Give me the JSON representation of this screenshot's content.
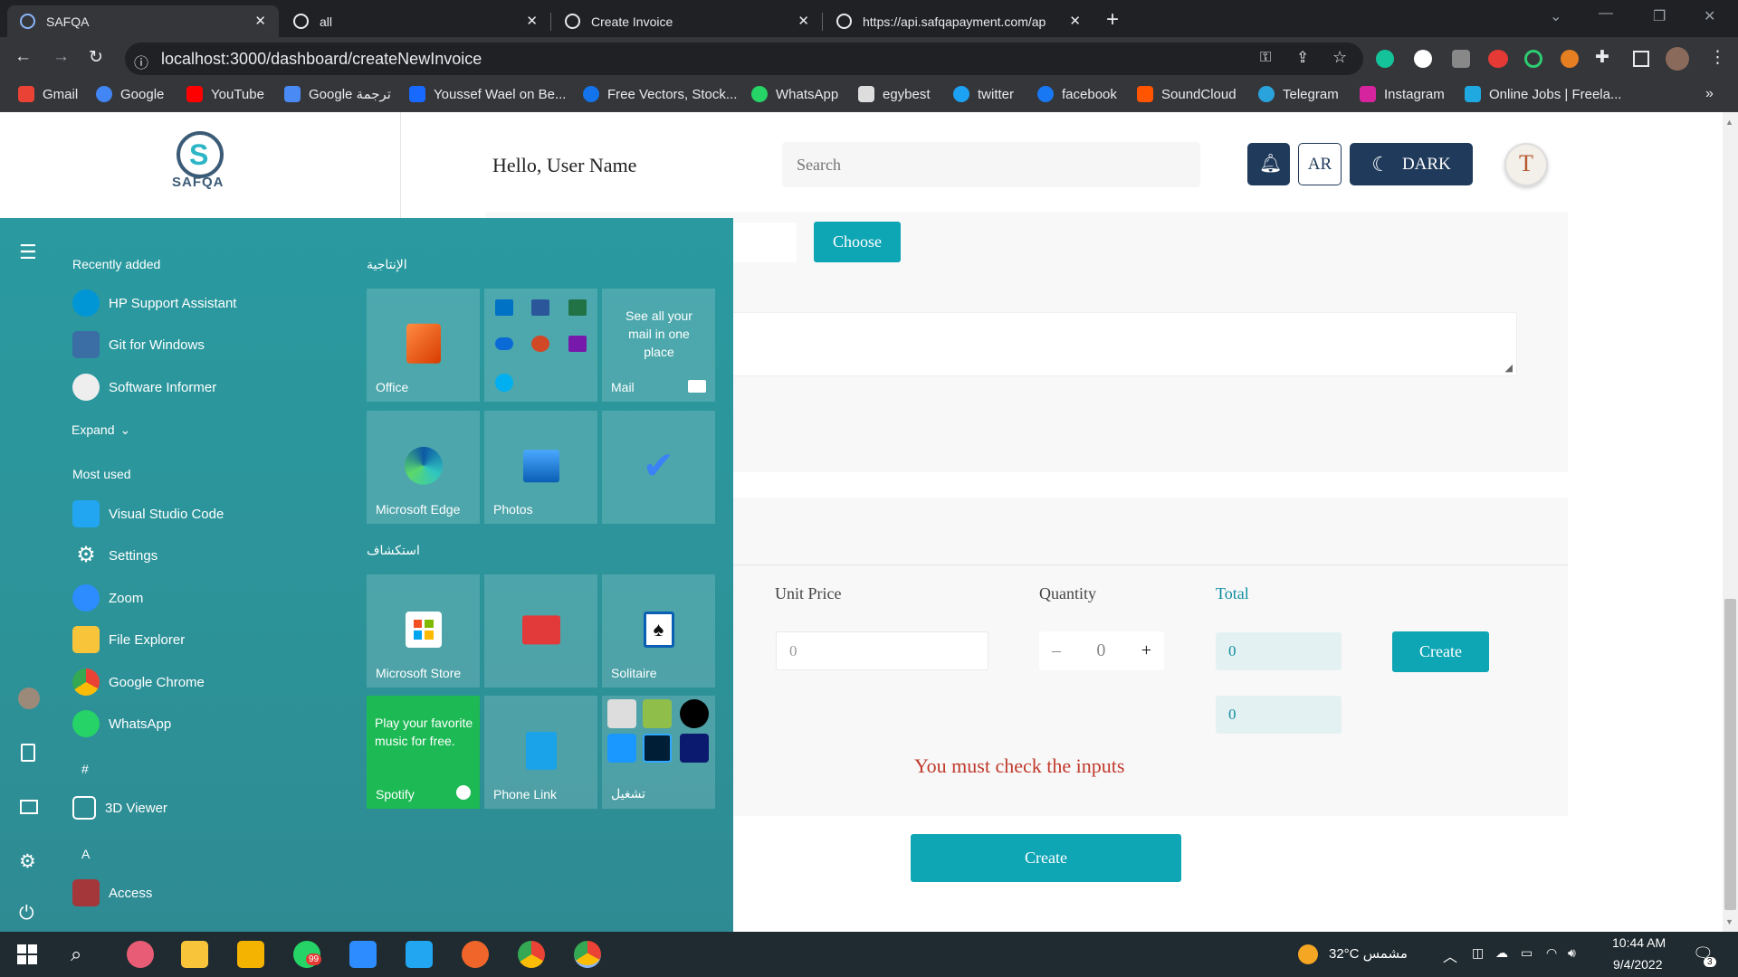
{
  "browser": {
    "tabs": [
      {
        "title": "SAFQA"
      },
      {
        "title": "all"
      },
      {
        "title": "Create Invoice"
      },
      {
        "title": "https://api.safqapayment.com/ap"
      }
    ],
    "url": "localhost:3000/dashboard/createNewInvoice",
    "bookmarks": [
      "Gmail",
      "Google",
      "YouTube",
      "Google ترجمة",
      "Youssef Wael on Be...",
      "Free Vectors, Stock...",
      "WhatsApp",
      "egybest",
      "twitter",
      "facebook",
      "SoundCloud",
      "Telegram",
      "Instagram",
      "Online Jobs | Freela..."
    ]
  },
  "header": {
    "logo_text": "SAFQA",
    "greeting": "Hello, User Name",
    "search_placeholder": "Search",
    "lang_button": "AR",
    "theme_button": "DARK"
  },
  "form": {
    "choose_button": "Choose",
    "columns": {
      "unit_price": "Unit Price",
      "quantity": "Quantity",
      "total": "Total"
    },
    "unit_price_placeholder": "0",
    "quantity_value": "0",
    "quantity_minus": "–",
    "quantity_plus": "+",
    "total_value": "0",
    "grand_total_value": "0",
    "row_create": "Create",
    "error": "You must check the inputs",
    "create_button": "Create"
  },
  "start_menu": {
    "recently_added_label": "Recently added",
    "recent": [
      "HP Support Assistant",
      "Git for Windows",
      "Software Informer"
    ],
    "expand": "Expand",
    "most_used_label": "Most used",
    "most_used": [
      "Visual Studio Code",
      "Settings",
      "Zoom",
      "File Explorer",
      "Google Chrome",
      "WhatsApp"
    ],
    "hash": "#",
    "viewer": "3D Viewer",
    "letter_a": "A",
    "access": "Access",
    "group_productivity": "الإنتاجية",
    "group_explore": "استكشاف",
    "tiles": {
      "office": "Office",
      "mail_text": "See all your mail in one place",
      "mail": "Mail",
      "edge": "Microsoft Edge",
      "photos": "Photos",
      "store": "Microsoft Store",
      "solitaire": "Solitaire",
      "spotify_text": "Play your favorite music for free.",
      "spotify": "Spotify",
      "phone_link": "Phone Link",
      "play": "تشغيل"
    }
  },
  "taskbar": {
    "weather": "32°C  مشمس",
    "time": "10:44 AM",
    "date": "9/4/2022",
    "whatsapp_badge": "99",
    "notif_badge": "3"
  },
  "colors": {
    "primary": "#0ea5b5",
    "navy": "#1f3a5a",
    "error": "#c0392b",
    "start_bg": "#2c9399"
  }
}
